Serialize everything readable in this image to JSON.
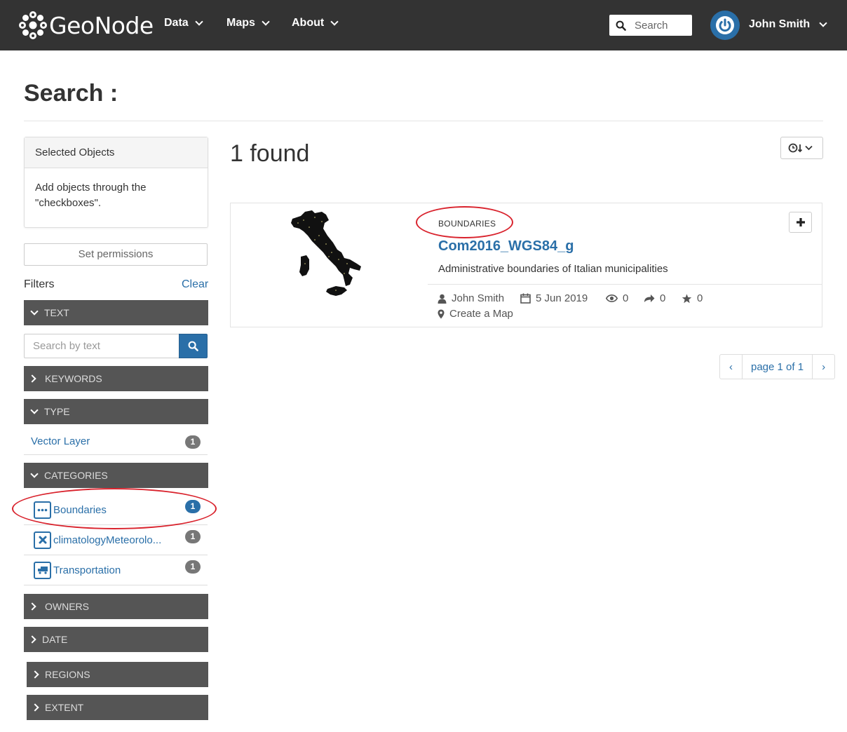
{
  "navbar": {
    "brand": "GeoNode",
    "menu": [
      {
        "label": "Data"
      },
      {
        "label": "Maps"
      },
      {
        "label": "About"
      }
    ],
    "search_placeholder": "Search",
    "user_name": "John Smith",
    "bg_color": "#333333",
    "avatar_color": "#2a6fa8"
  },
  "page": {
    "title": "Search :"
  },
  "sidebar": {
    "selected_objects": {
      "title": "Selected Objects",
      "body": "Add objects through the \"checkboxes\"."
    },
    "set_permissions_label": "Set permissions",
    "filters_label": "Filters",
    "clear_label": "Clear",
    "sections": {
      "text": "TEXT",
      "keywords": "KEYWORDS",
      "type": "TYPE",
      "categories": "CATEGORIES",
      "owners": "OWNERS",
      "date": "DATE",
      "regions": "REGIONS",
      "extent": "EXTENT"
    },
    "text_search_placeholder": "Search by text",
    "type_items": [
      {
        "label": "Vector Layer",
        "count": "1"
      }
    ],
    "category_items": [
      {
        "label": "Boundaries",
        "count": "1",
        "icon": "ellipsis-icon",
        "active": true
      },
      {
        "label": "climatologyMeteorolo...",
        "count": "1",
        "icon": "times-icon",
        "active": false
      },
      {
        "label": "Transportation",
        "count": "1",
        "icon": "truck-icon",
        "active": false
      }
    ]
  },
  "results": {
    "found_text": "1 found",
    "items": [
      {
        "category": "BOUNDARIES",
        "title": "Com2016_WGS84_g",
        "abstract": "Administrative boundaries of Italian municipalities",
        "owner": "John Smith",
        "date": "5 Jun 2019",
        "views": "0",
        "shares": "0",
        "ratings": "0",
        "create_map": "Create a Map"
      }
    ]
  },
  "pagination": {
    "prev": "‹",
    "label": "page 1 of 1",
    "next": "›"
  },
  "colors": {
    "accent": "#2a6fa8",
    "filter_bar": "#555555",
    "highlight": "#d9232d"
  }
}
